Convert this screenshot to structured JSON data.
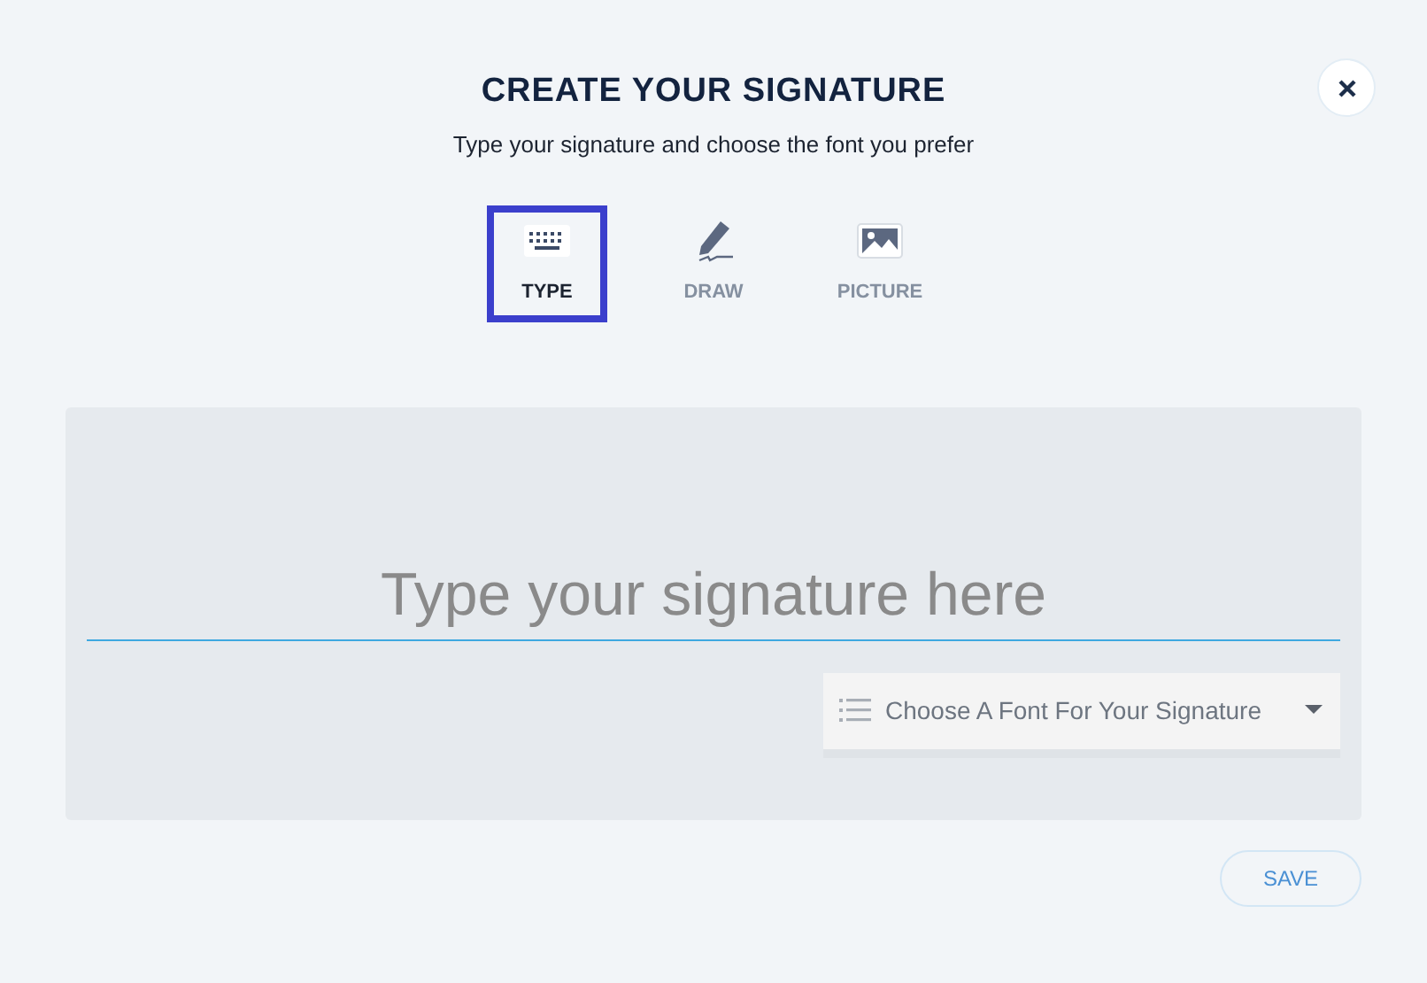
{
  "title": "CREATE YOUR SIGNATURE",
  "subtitle": "Type your signature and choose the font you prefer",
  "tabs": [
    {
      "kind": "keyboard",
      "label": "TYPE",
      "selected": true
    },
    {
      "kind": "pen",
      "label": "DRAW",
      "selected": false
    },
    {
      "kind": "image",
      "label": "PICTURE",
      "selected": false
    }
  ],
  "signature_field": {
    "placeholder": "Type your signature here"
  },
  "font_dropdown": {
    "label": "Choose A Font For Your Signature"
  },
  "save_button": "SAVE"
}
